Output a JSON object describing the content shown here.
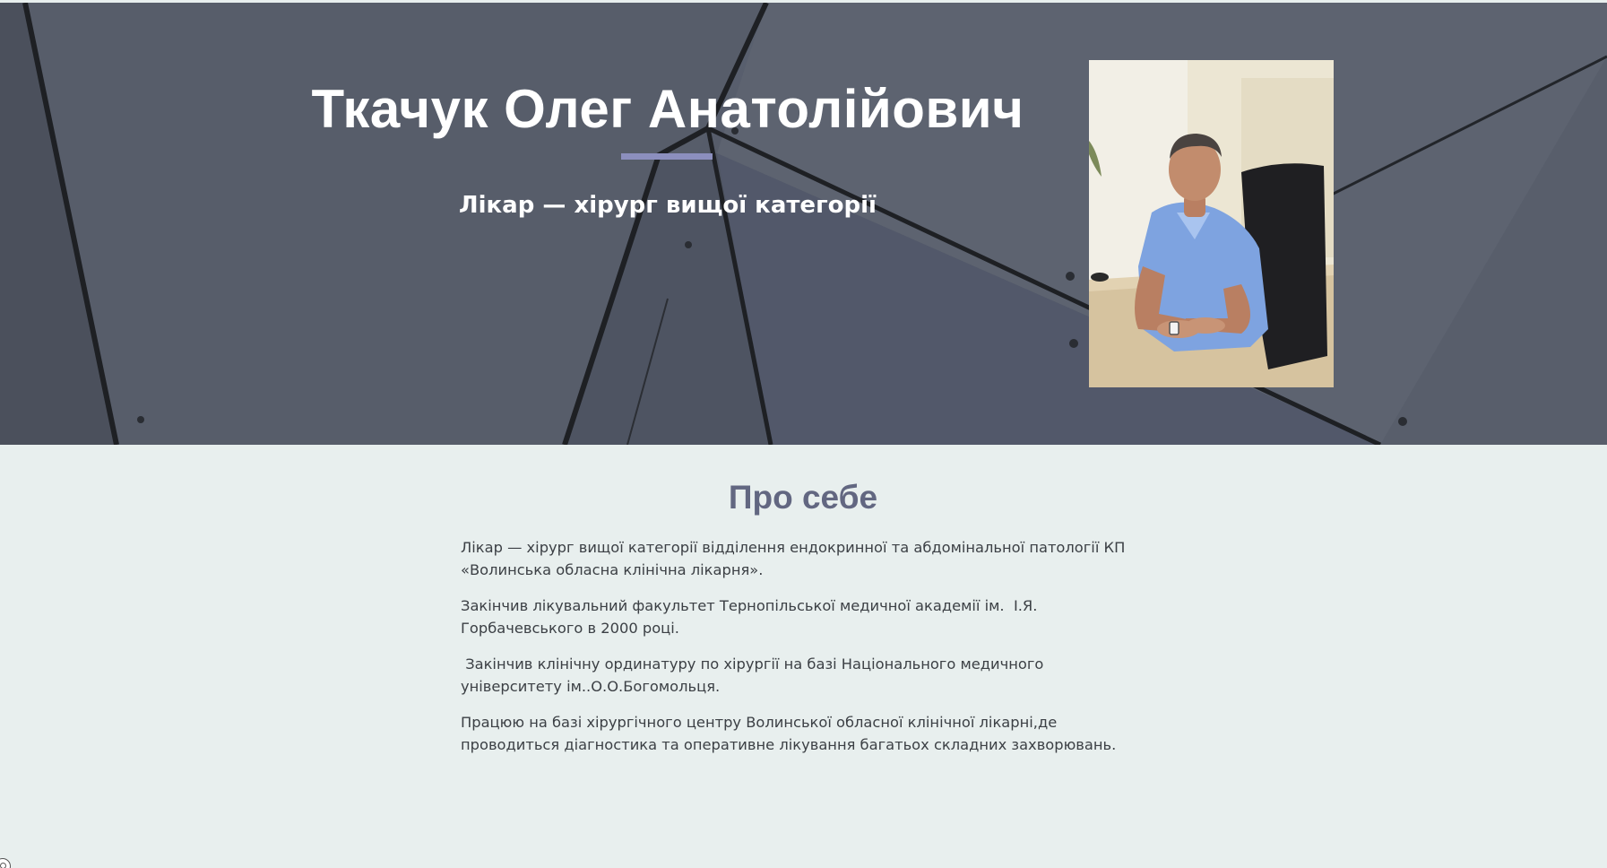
{
  "hero": {
    "name": "Ткачук Олег Анатолійович",
    "subtitle": "Лікар — хірург вищої категорії",
    "photo_alt": "Портрет лікаря",
    "accent_color": "#8c8fbe"
  },
  "about": {
    "heading": "Про себе",
    "paragraphs": [
      "Лікар — хірург вищої категорії відділення ендокринної та абдомінальної патології КП «Волинська обласна клінічна лікарня».",
      "Закінчив лікувальний факультет Тернопільської медичної академії ім.  І.Я. Горбачевського в 2000 році.",
      " Закінчив клінічну ординатуру по хірургії на базі Національного медичного університету ім..О.О.Богомольця.",
      "Працюю на базі хірургічного центру Волинської обласної клінічної лікарні,де проводиться діагностика та оперативне лікування багатьох складних захворювань."
    ],
    "heading_color": "#626781"
  }
}
